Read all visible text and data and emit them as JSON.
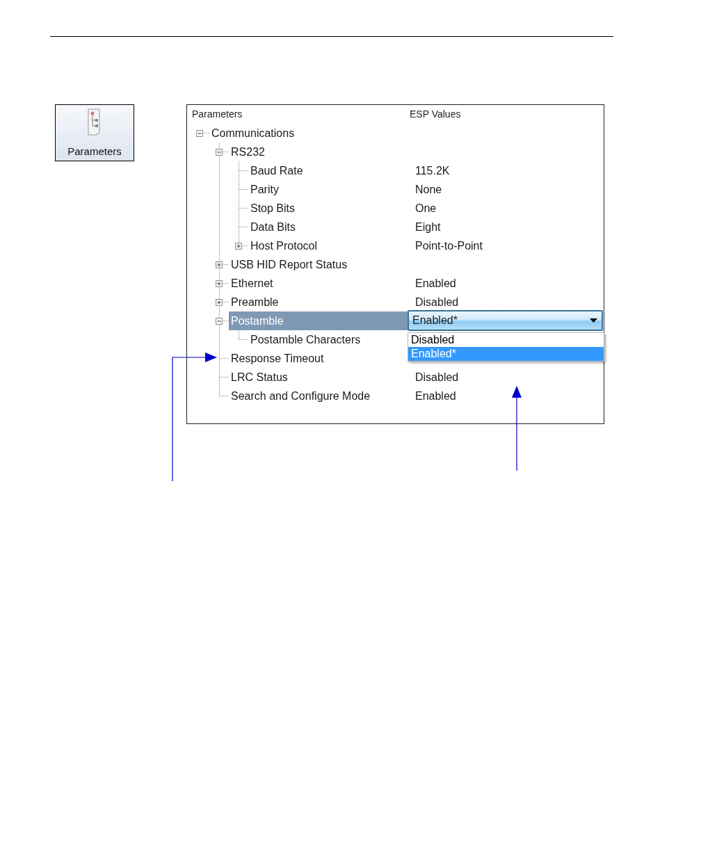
{
  "toolbar_button": {
    "label": "Parameters"
  },
  "tree": {
    "columns": [
      "Parameters",
      "ESP Values"
    ],
    "items": [
      {
        "label": "Communications",
        "selected": false,
        "expanded": true,
        "children": [
          {
            "label": "RS232",
            "selected": false,
            "expanded": true,
            "children": [
              {
                "label": "Baud Rate",
                "value": "115.2K",
                "selected": false
              },
              {
                "label": "Parity",
                "value": "None",
                "selected": false
              },
              {
                "label": "Stop Bits",
                "value": "One",
                "selected": false
              },
              {
                "label": "Data Bits",
                "value": "Eight",
                "selected": false
              },
              {
                "label": "Host Protocol",
                "value": "Point-to-Point",
                "selected": false,
                "expanded": false
              }
            ]
          },
          {
            "label": "USB HID Report Status",
            "selected": false,
            "expanded": false
          },
          {
            "label": "Ethernet",
            "value": "Enabled",
            "selected": false,
            "expanded": false
          },
          {
            "label": "Preamble",
            "value": "Disabled",
            "selected": false,
            "expanded": false
          },
          {
            "label": "Postamble",
            "selected": true,
            "expanded": true,
            "editor": {
              "value": "Enabled*",
              "open": true,
              "options": [
                {
                  "label": "Disabled",
                  "selected": false
                },
                {
                  "label": "Enabled*",
                  "selected": true
                }
              ]
            },
            "children": [
              {
                "label": "Postamble Characters",
                "selected": false
              }
            ]
          },
          {
            "label": "Response Timeout",
            "selected": false
          },
          {
            "label": "LRC Status",
            "value": "Disabled",
            "selected": false
          },
          {
            "label": "Search and Configure Mode",
            "value": "Enabled",
            "selected": false
          }
        ]
      }
    ]
  }
}
